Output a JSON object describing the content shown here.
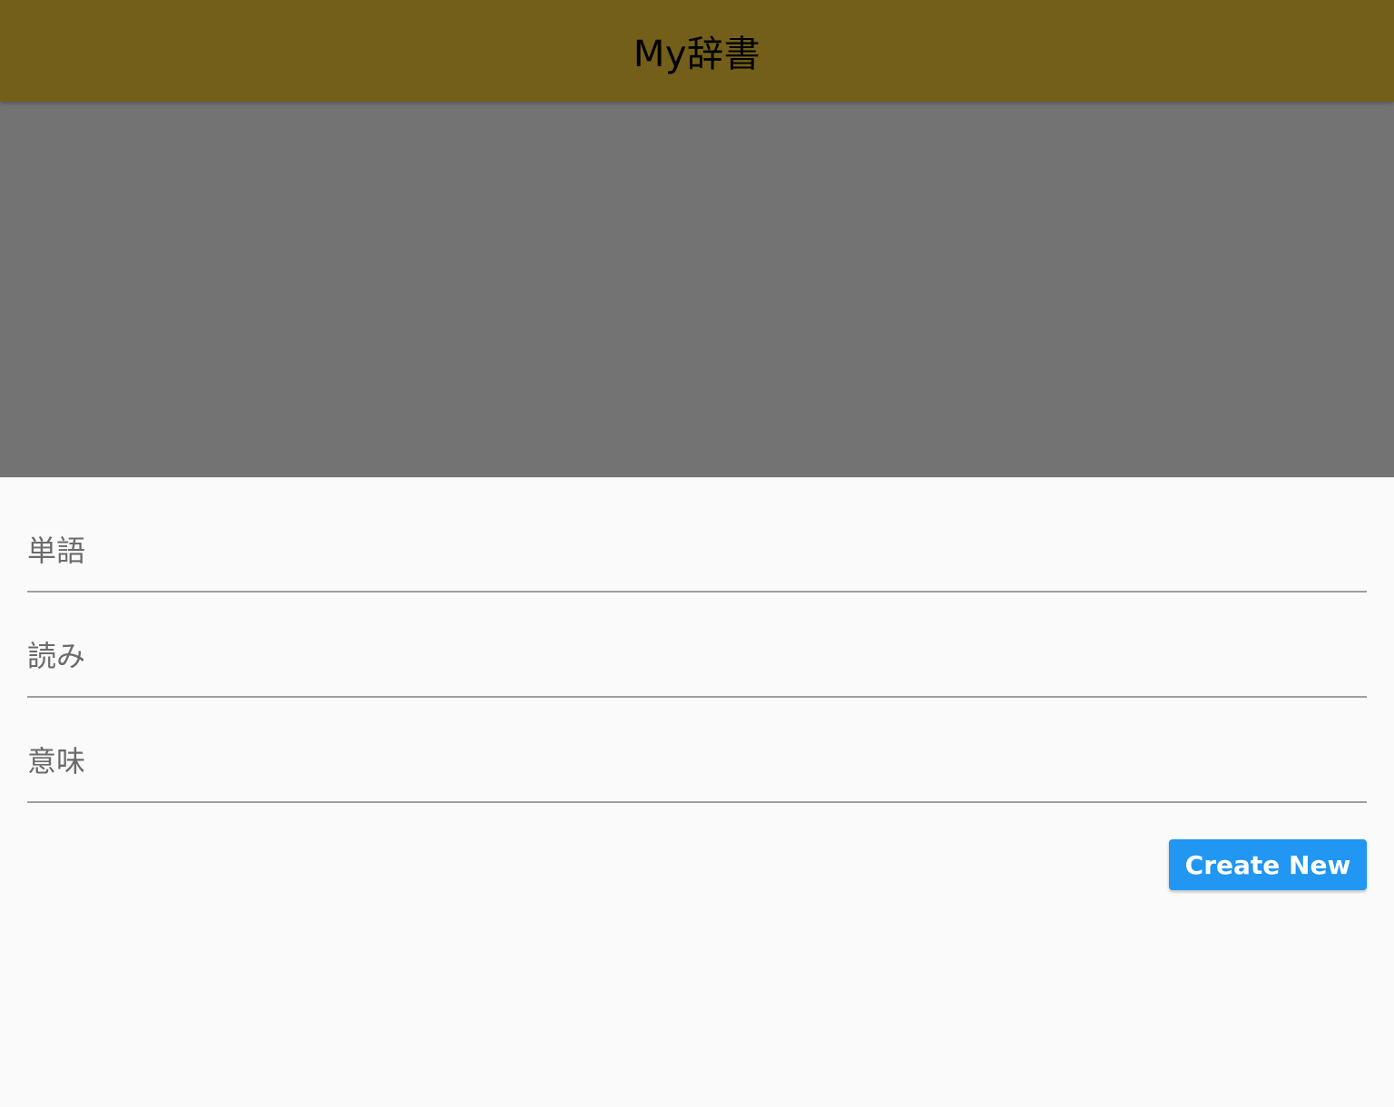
{
  "app_bar": {
    "title": "My辞書",
    "background_color": "#735f19"
  },
  "form": {
    "fields": [
      {
        "placeholder": "単語",
        "value": ""
      },
      {
        "placeholder": "読み",
        "value": ""
      },
      {
        "placeholder": "意味",
        "value": ""
      }
    ],
    "submit_label": "Create New",
    "submit_color": "#2196f3"
  }
}
